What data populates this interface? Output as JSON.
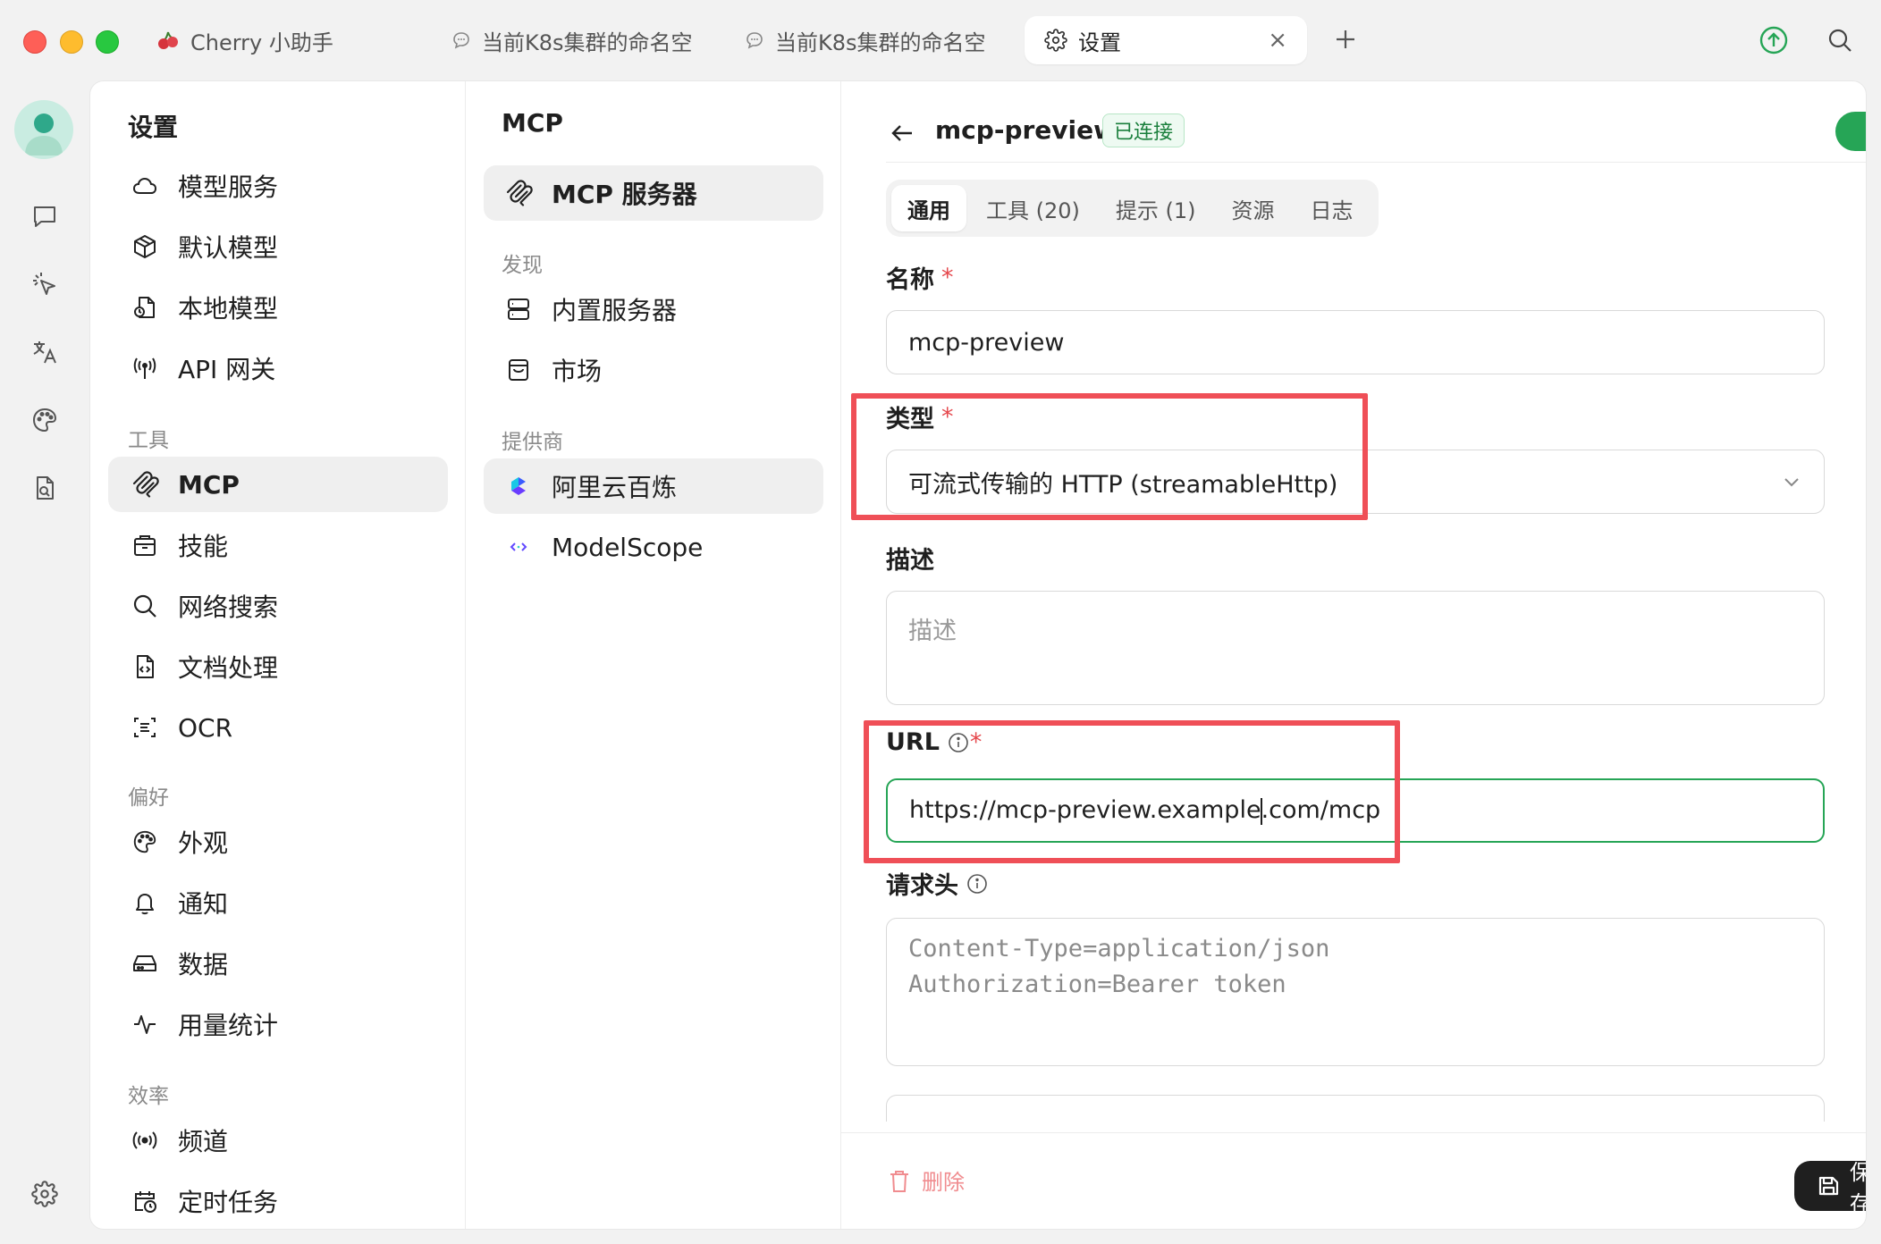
{
  "window": {
    "tabs": [
      {
        "title": "Cherry 小助手",
        "icon": "cherry-icon"
      },
      {
        "title": "当前K8s集群的命名空",
        "icon": "chat-bubble-icon"
      },
      {
        "title": "当前K8s集群的命名空",
        "icon": "chat-bubble-icon"
      },
      {
        "title": "设置",
        "icon": "gear-icon",
        "active": true
      }
    ],
    "tab_close": "×"
  },
  "settings_nav": {
    "title": "设置",
    "items_top": [
      {
        "label": "模型服务",
        "icon": "cloud-icon"
      },
      {
        "label": "默认模型",
        "icon": "cube-icon"
      },
      {
        "label": "本地模型",
        "icon": "local-model-icon"
      },
      {
        "label": "API 网关",
        "icon": "antenna-icon"
      }
    ],
    "section_tools": "工具",
    "items_tools": [
      {
        "label": "MCP",
        "icon": "mcp-icon",
        "active": true
      },
      {
        "label": "技能",
        "icon": "skills-icon"
      },
      {
        "label": "网络搜索",
        "icon": "search-icon"
      },
      {
        "label": "文档处理",
        "icon": "document-icon"
      },
      {
        "label": "OCR",
        "icon": "ocr-icon"
      }
    ],
    "section_prefs": "偏好",
    "items_prefs": [
      {
        "label": "外观",
        "icon": "palette-icon"
      },
      {
        "label": "通知",
        "icon": "bell-icon"
      },
      {
        "label": "数据",
        "icon": "drive-icon"
      },
      {
        "label": "用量统计",
        "icon": "activity-icon"
      }
    ],
    "section_efficiency": "效率",
    "items_efficiency": [
      {
        "label": "频道",
        "icon": "broadcast-icon"
      },
      {
        "label": "定时任务",
        "icon": "calendar-clock-icon"
      }
    ]
  },
  "mcp_nav": {
    "title": "MCP",
    "servers_label": "MCP 服务器",
    "section_discover": "发现",
    "discover_items": [
      {
        "label": "内置服务器",
        "icon": "server-icon"
      },
      {
        "label": "市场",
        "icon": "shopping-bag-icon"
      }
    ],
    "section_providers": "提供商",
    "provider_items": [
      {
        "label": "阿里云百炼",
        "icon": "bailian-logo-icon",
        "active": true
      },
      {
        "label": "ModelScope",
        "icon": "modelscope-logo-icon"
      }
    ]
  },
  "detail": {
    "server_name": "mcp-preview",
    "status": "已连接",
    "enabled": true,
    "tabs": [
      "通用",
      "工具 (20)",
      "提示 (1)",
      "资源",
      "日志"
    ],
    "active_tab": "通用",
    "name_label": "名称",
    "name_value": "mcp-preview",
    "type_label": "类型",
    "type_value": "可流式传输的 HTTP (streamableHttp)",
    "desc_label": "描述",
    "desc_placeholder": "描述",
    "url_label": "URL",
    "url_value_before_caret": "https://mcp-preview.example",
    "url_value_after_caret": ".com/mcp",
    "headers_label": "请求头",
    "headers_placeholder_line1": "Content-Type=application/json",
    "headers_placeholder_line2": "Authorization=Bearer token",
    "required_mark": "*",
    "delete_label": "删除",
    "save_label": "保存"
  },
  "colors": {
    "accent_green": "#26a556",
    "highlight_red": "#ef4f57",
    "danger": "#e5484d"
  }
}
